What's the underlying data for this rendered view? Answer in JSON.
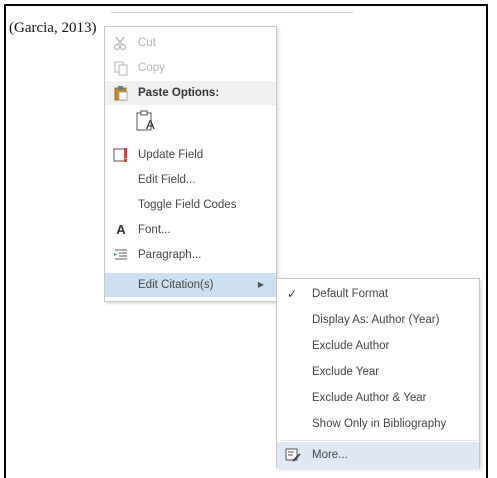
{
  "document": {
    "citation_text": "(Garcia, 2013)"
  },
  "context_menu": {
    "items": [
      {
        "label": "Cut",
        "icon": "scissors-icon",
        "enabled": false
      },
      {
        "label": "Copy",
        "icon": "copy-icon",
        "enabled": false
      },
      {
        "label": "Paste Options:",
        "icon": "clipboard-icon",
        "header": true
      },
      {
        "label": "Update Field",
        "icon": "update-field-icon"
      },
      {
        "label": "Edit Field...",
        "icon": ""
      },
      {
        "label": "Toggle Field Codes",
        "icon": ""
      },
      {
        "label": "Font...",
        "icon": "font-icon"
      },
      {
        "label": "Paragraph...",
        "icon": "paragraph-icon"
      },
      {
        "label": "Edit Citation(s)",
        "icon": "",
        "has_submenu": true,
        "active": true
      }
    ],
    "paste_option_glyph": "A"
  },
  "submenu": {
    "items": [
      {
        "label": "Default Format",
        "checked": true
      },
      {
        "label": "Display As: Author (Year)"
      },
      {
        "label": "Exclude Author"
      },
      {
        "label": "Exclude Year"
      },
      {
        "label": "Exclude Author & Year"
      },
      {
        "label": "Show Only in Bibliography"
      },
      {
        "label": "More...",
        "icon": "edit-citation-icon",
        "hover": true
      }
    ]
  },
  "colors": {
    "highlight": "#cde0f3",
    "hover": "#dfe9f5",
    "disabled_text": "#b3b3b3",
    "menu_text": "#444444"
  }
}
